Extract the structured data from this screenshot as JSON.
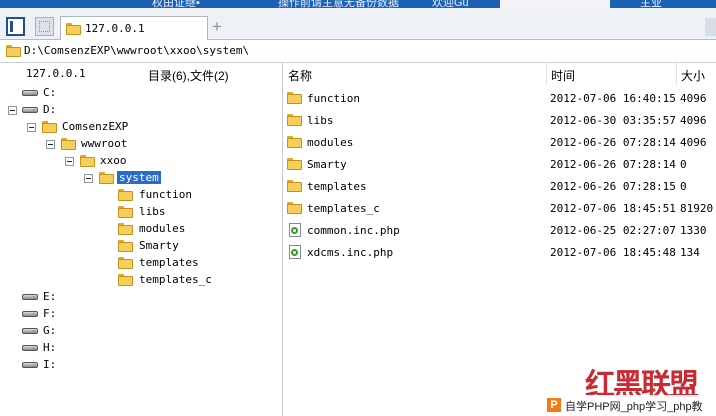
{
  "topstrip": {
    "left_text": "权由证继▪",
    "mid_text": "操作前请主意无备份数据",
    "right_text": "欢迎Gu",
    "far_text": "主业"
  },
  "tabs": [
    {
      "label": "127.0.0.1"
    }
  ],
  "new_tab_symbol": "+",
  "address": {
    "path": "D:\\ComsenzEXP\\wwwroot\\xxoo\\system\\"
  },
  "left_header": {
    "host": "127.0.0.1",
    "summary": "目录(6),文件(2)"
  },
  "columns": {
    "name": "名称",
    "time": "时间",
    "size": "大小"
  },
  "tree": {
    "drives_top": [
      "C:",
      "D:"
    ],
    "comsenz": "ComsenzEXP",
    "wwwroot": "wwwroot",
    "xxoo": "xxoo",
    "system": "system",
    "children": [
      "function",
      "libs",
      "modules",
      "Smarty",
      "templates",
      "templates_c"
    ],
    "drives_bottom": [
      "E:",
      "F:",
      "G:",
      "H:",
      "I:"
    ]
  },
  "files": [
    {
      "name": "function",
      "time": "2012-07-06 16:40:15",
      "size": "4096",
      "type": "folder"
    },
    {
      "name": "libs",
      "time": "2012-06-30 03:35:57",
      "size": "4096",
      "type": "folder"
    },
    {
      "name": "modules",
      "time": "2012-06-26 07:28:14",
      "size": "4096",
      "type": "folder"
    },
    {
      "name": "Smarty",
      "time": "2012-06-26 07:28:14",
      "size": "0",
      "type": "folder"
    },
    {
      "name": "templates",
      "time": "2012-06-26 07:28:15",
      "size": "0",
      "type": "folder"
    },
    {
      "name": "templates_c",
      "time": "2012-07-06 18:45:51",
      "size": "81920",
      "type": "folder"
    },
    {
      "name": "common.inc.php",
      "time": "2012-06-25 02:27:07",
      "size": "1330",
      "type": "php"
    },
    {
      "name": "xdcms.inc.php",
      "time": "2012-07-06 18:45:48",
      "size": "134",
      "type": "php"
    }
  ],
  "watermark": {
    "text": "红黑联盟",
    "banner_logo": "P",
    "banner": "自学PHP网_php学习_php教"
  },
  "colors": {
    "selection": "#2a6cc8",
    "folder": "#f6cf5b",
    "title_bar": "#1c62b4",
    "watermark": "#c4141d"
  }
}
